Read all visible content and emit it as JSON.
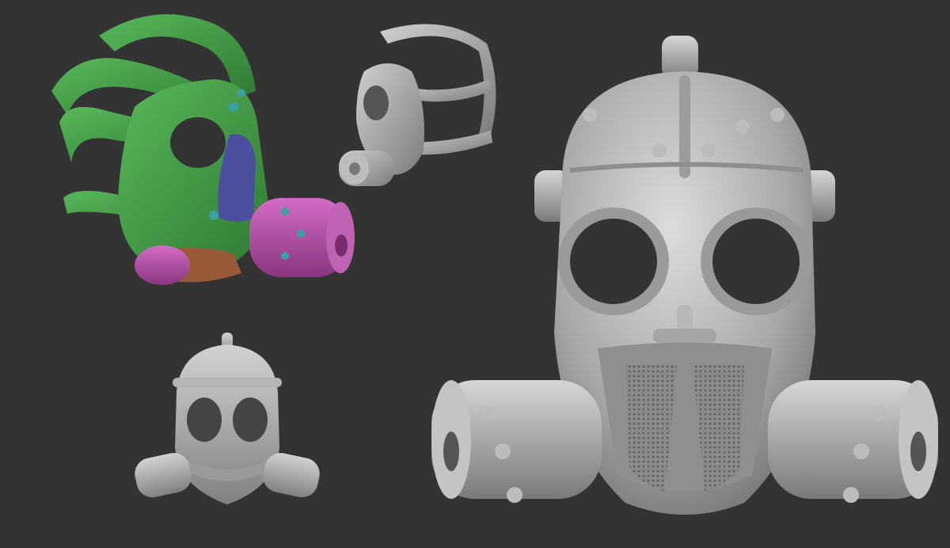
{
  "scene": {
    "background_color": "#333333",
    "description_visible_text": "",
    "renders": [
      {
        "name": "colored-gas-mask-three-quarter-view",
        "colors": {
          "straps": "#3f9a42",
          "canister": "#b24aa6",
          "lens_rim": "#4b4f9e",
          "filter_brown": "#9a5a3a",
          "rivets": "#3aa0a0"
        }
      },
      {
        "name": "gray-gas-mask-side-view",
        "colors": {
          "clay": "#a8a8a8"
        }
      },
      {
        "name": "gray-gas-mask-front-view-small",
        "colors": {
          "clay": "#a8a8a8"
        }
      },
      {
        "name": "gray-gas-mask-front-view-large",
        "colors": {
          "clay": "#a8a8a8"
        }
      }
    ]
  }
}
